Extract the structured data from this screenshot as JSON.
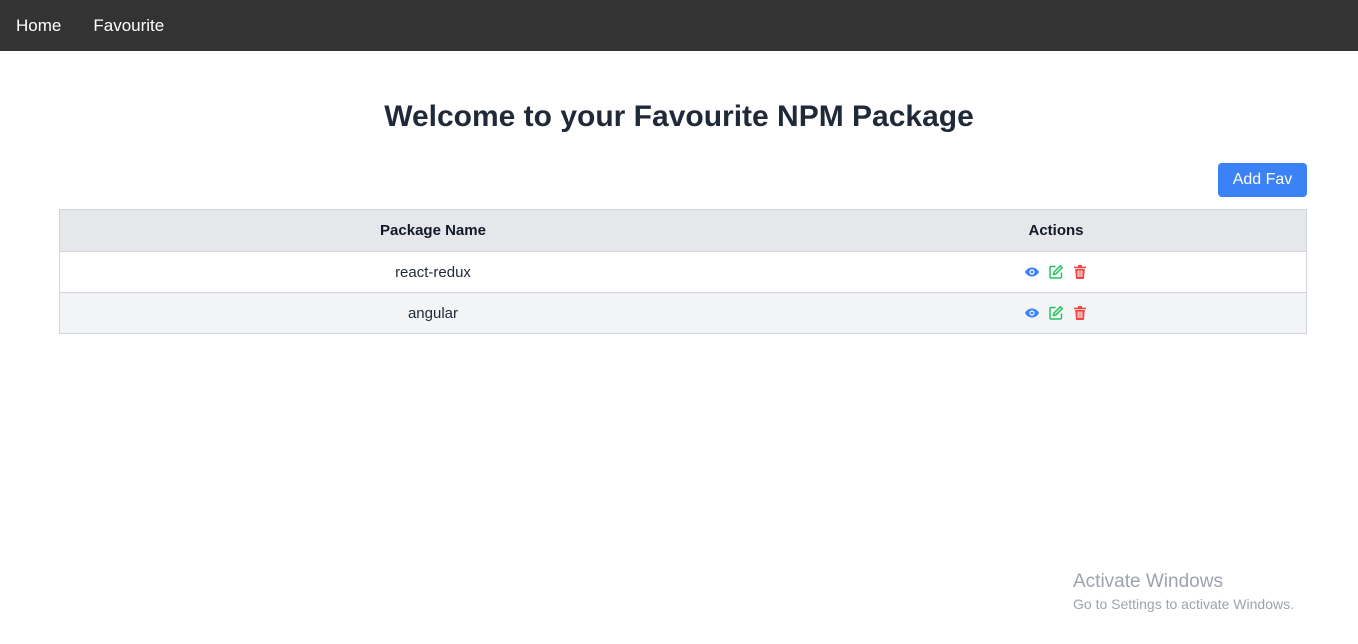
{
  "nav": {
    "items": [
      {
        "label": "Home"
      },
      {
        "label": "Favourite"
      }
    ]
  },
  "main": {
    "title": "Welcome to your Favourite NPM Package",
    "add_button": "Add Fav"
  },
  "table": {
    "headers": {
      "name": "Package Name",
      "actions": "Actions"
    },
    "rows": [
      {
        "name": "react-redux"
      },
      {
        "name": "angular"
      }
    ]
  },
  "icons": {
    "view": "eye-icon",
    "edit": "edit-icon",
    "delete": "trash-icon"
  },
  "colors": {
    "navbar": "#333333",
    "accent": "#3b82f6",
    "view": "#3b82f6",
    "edit": "#22c55e",
    "delete": "#ef4444"
  },
  "watermark": {
    "title": "Activate Windows",
    "subtitle": "Go to Settings to activate Windows."
  }
}
